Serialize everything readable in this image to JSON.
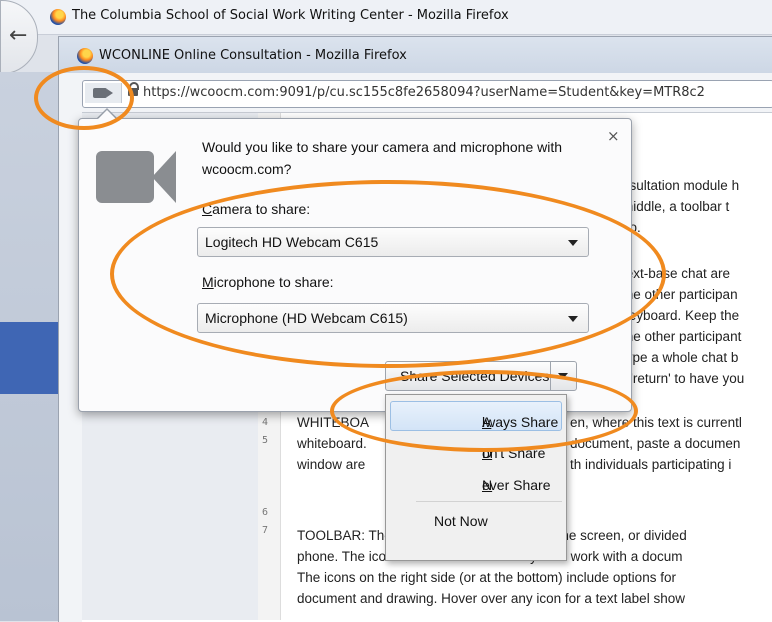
{
  "outer_window": {
    "title": "The Columbia School of Social Work Writing Center - Mozilla Firefox"
  },
  "inner_window": {
    "title": "WCONLINE Online Consultation - Mozilla Firefox",
    "url": "https://wcoocm.com:9091/p/cu.sc155c8fe2658094?userName=Student&key=MTR8c2"
  },
  "permission_prompt": {
    "question": "Would you like to share your camera and microphone with wcoocm.com?",
    "camera_label_accel": "C",
    "camera_label_rest": "amera to share:",
    "camera_value": "Logitech HD Webcam C615",
    "microphone_label_accel": "M",
    "microphone_label_rest": "icrophone to share:",
    "microphone_value": "Microphone (HD Webcam C615)",
    "share_button_label": "Share Selected Devices",
    "close_glyph": "×"
  },
  "share_menu": {
    "items": [
      {
        "accel": "A",
        "rest": "lways Share"
      },
      {
        "accel": "D",
        "rest": "on't Share"
      },
      {
        "accel": "N",
        "rest": "ever Share"
      },
      {
        "accel": "",
        "rest": "Not Now"
      }
    ]
  },
  "document": {
    "lines": [
      "nsultation module h",
      "middle, a toolbar t",
      "eo.",
      "text-base  chat are",
      " the other participan",
      "keyboard. Keep the",
      "the other participant",
      "type a whole chat b",
      "r 'return' to have you",
      "WHITEBOA",
      "en, where this text is currentl",
      "whiteboard.",
      "document, paste a documen",
      "window are",
      "th individuals participating i",
      "TOOLBAR: The toolbar is across the top of the screen, or divided",
      "phone. The icons on the left side allow you to work with a docum",
      "The icons on the right side (or at the bottom) include options for",
      "document and drawing. Hover over any icon for a text label show"
    ],
    "line_numbers": [
      "4",
      "5",
      "6",
      "7"
    ]
  },
  "icons": {
    "camera": "camera-icon",
    "lock": "lock-icon",
    "firefox": "firefox-logo-icon",
    "back": "back-arrow-icon"
  },
  "colors": {
    "annotation": "#f08a1f"
  }
}
